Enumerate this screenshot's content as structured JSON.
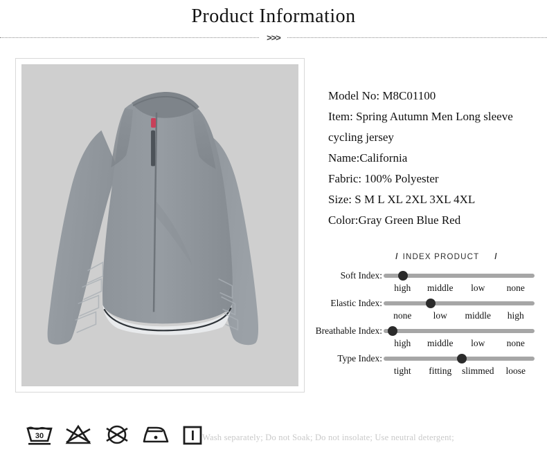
{
  "header": {
    "title": "Product Information",
    "divider_marker": ">>>"
  },
  "product_image": {
    "alt": "gray long sleeve cycling jersey front view",
    "background_color": "#cfcfcf",
    "frame_border_color": "#d8d8d8"
  },
  "specs": {
    "lines": [
      "Model No: M8C01100",
      "Item: Spring Autumn Men Long sleeve cycling jersey",
      "Name:California",
      "Fabric: 100% Polyester",
      "Size: S M L XL 2XL 3XL 4XL",
      "Color:Gray Green Blue Red"
    ]
  },
  "index_product": {
    "heading": "INDEX PRODUCT",
    "slash_left": "/",
    "slash_right": "/",
    "sliders": [
      {
        "label": "Soft Index:",
        "options": [
          "high",
          "middle",
          "low",
          "none"
        ],
        "handle_percent": 13,
        "selected": "high"
      },
      {
        "label": "Elastic Index:",
        "options": [
          "none",
          "low",
          "middle",
          "high"
        ],
        "handle_percent": 31,
        "selected": "low"
      },
      {
        "label": "Breathable Index:",
        "options": [
          "high",
          "middle",
          "low",
          "none"
        ],
        "handle_percent": 6,
        "selected": "high"
      },
      {
        "label": "Type Index:",
        "options": [
          "tight",
          "fitting",
          "slimmed",
          "loose"
        ],
        "handle_percent": 52,
        "selected": "slimmed"
      }
    ]
  },
  "care": {
    "icons": [
      {
        "name": "wash-30-icon",
        "label": "30"
      },
      {
        "name": "do-not-bleach-icon",
        "label": ""
      },
      {
        "name": "do-not-tumble-dry-icon",
        "label": ""
      },
      {
        "name": "iron-low-icon",
        "label": ""
      },
      {
        "name": "drip-dry-icon",
        "label": ""
      }
    ],
    "instructions": "Wash separately; Do not Soak; Do not insolate; Use neutral detergent;"
  },
  "colors": {
    "text": "#111111",
    "muted_text": "#c9c9c9",
    "slider_track": "#a6a6a6",
    "slider_handle": "#2b2b2b"
  }
}
